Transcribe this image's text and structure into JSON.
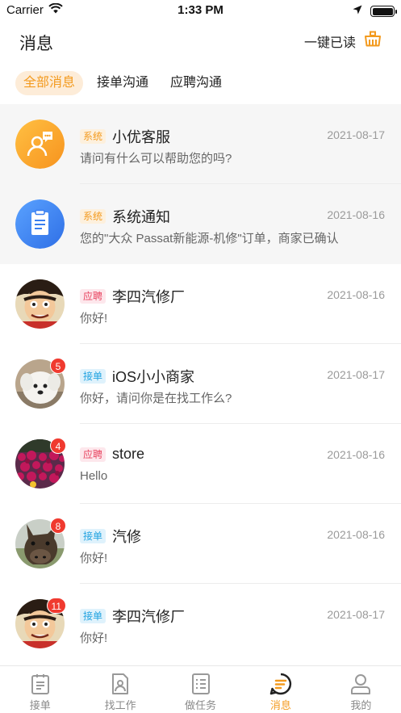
{
  "status_bar": {
    "carrier": "Carrier",
    "time": "1:33 PM"
  },
  "header": {
    "title": "消息",
    "mark_read_label": "一键已读"
  },
  "tabs": [
    {
      "label": "全部消息",
      "active": true
    },
    {
      "label": "接单沟通",
      "active": false
    },
    {
      "label": "应聘沟通",
      "active": false
    }
  ],
  "messages": [
    {
      "tag": "系统",
      "tag_type": "system",
      "name": "小优客服",
      "date": "2021-08-17",
      "preview": "请问有什么可以帮助您的吗?",
      "avatar": "customer-service-avatar",
      "badge": ""
    },
    {
      "tag": "系统",
      "tag_type": "system",
      "name": "系统通知",
      "date": "2021-08-16",
      "preview": "您的\"大众 Passat新能源-机修\"订单，商家已确认",
      "avatar": "system-notice-avatar",
      "badge": ""
    },
    {
      "tag": "应聘",
      "tag_type": "recruit",
      "name": "李四汽修厂",
      "date": "2021-08-16",
      "preview": "你好!",
      "avatar": "cartoon-pirate-avatar",
      "badge": ""
    },
    {
      "tag": "接单",
      "tag_type": "order",
      "name": "iOS小小商家",
      "date": "2021-08-17",
      "preview": "你好，请问你是在找工作么?",
      "avatar": "white-dog-avatar",
      "badge": "5"
    },
    {
      "tag": "应聘",
      "tag_type": "recruit",
      "name": "store",
      "date": "2021-08-16",
      "preview": "Hello",
      "avatar": "flower-avatar",
      "badge": "4"
    },
    {
      "tag": "接单",
      "tag_type": "order",
      "name": "汽修",
      "date": "2021-08-16",
      "preview": "你好!",
      "avatar": "horse-avatar",
      "badge": "8"
    },
    {
      "tag": "接单",
      "tag_type": "order",
      "name": "李四汽修厂",
      "date": "2021-08-17",
      "preview": "你好!",
      "avatar": "cartoon-pirate-avatar",
      "badge": "11"
    }
  ],
  "tab_bar": [
    {
      "label": "接单",
      "icon": "clipboard-icon",
      "active": false
    },
    {
      "label": "找工作",
      "icon": "resume-icon",
      "active": false
    },
    {
      "label": "做任务",
      "icon": "task-list-icon",
      "active": false
    },
    {
      "label": "消息",
      "icon": "message-icon",
      "active": true
    },
    {
      "label": "我的",
      "icon": "person-icon",
      "active": false
    }
  ],
  "colors": {
    "accent": "#f39a1e",
    "badge": "#f03a2f",
    "pinned_bg": "#f6f6f6"
  }
}
